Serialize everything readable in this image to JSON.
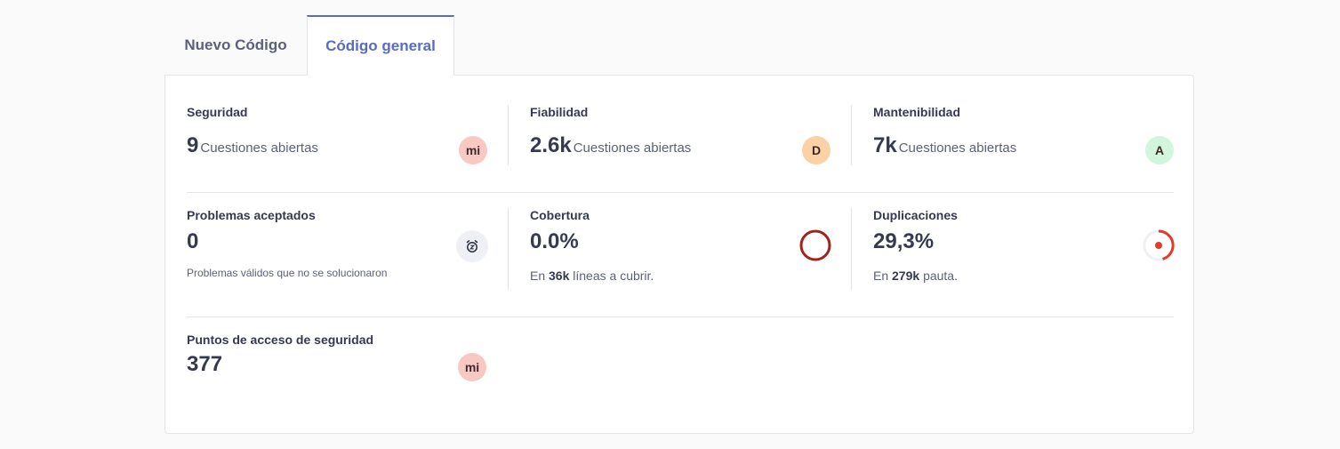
{
  "tabs": [
    {
      "label": "Nuevo Código",
      "active": false
    },
    {
      "label": "Código general",
      "active": true
    }
  ],
  "security": {
    "label": "Seguridad",
    "value": "9",
    "suffix": "Cuestiones abiertas",
    "rating": "mi",
    "rating_color": "#f8c9c3"
  },
  "reliability": {
    "label": "Fiabilidad",
    "value": "2.6k",
    "suffix": "Cuestiones abiertas",
    "rating": "D",
    "rating_color": "#fbd1a6"
  },
  "maintainability": {
    "label": "Mantenibilidad",
    "value": "7k",
    "suffix": "Cuestiones abiertas",
    "rating": "A",
    "rating_color": "#d3f5db"
  },
  "accepted": {
    "label": "Problemas aceptados",
    "value": "0",
    "note": "Problemas válidos que no se solucionaron",
    "icon": "alarm-clock-icon"
  },
  "coverage": {
    "label": "Cobertura",
    "value": "0.0%",
    "note_prefix": "En",
    "note_strong": "36k",
    "note_suffix": "líneas a cubrir.",
    "ring_color": "#a3221d",
    "coverage_fraction": 0.0
  },
  "duplications": {
    "label": "Duplicaciones",
    "value": "29,3%",
    "note_prefix": "En",
    "note_strong": "279k",
    "note_suffix": "pauta.",
    "accent_color": "#e5392b"
  },
  "hotspots": {
    "label": "Puntos de acceso de seguridad",
    "value": "377",
    "rating": "mi",
    "rating_color": "#f8c9c3"
  }
}
